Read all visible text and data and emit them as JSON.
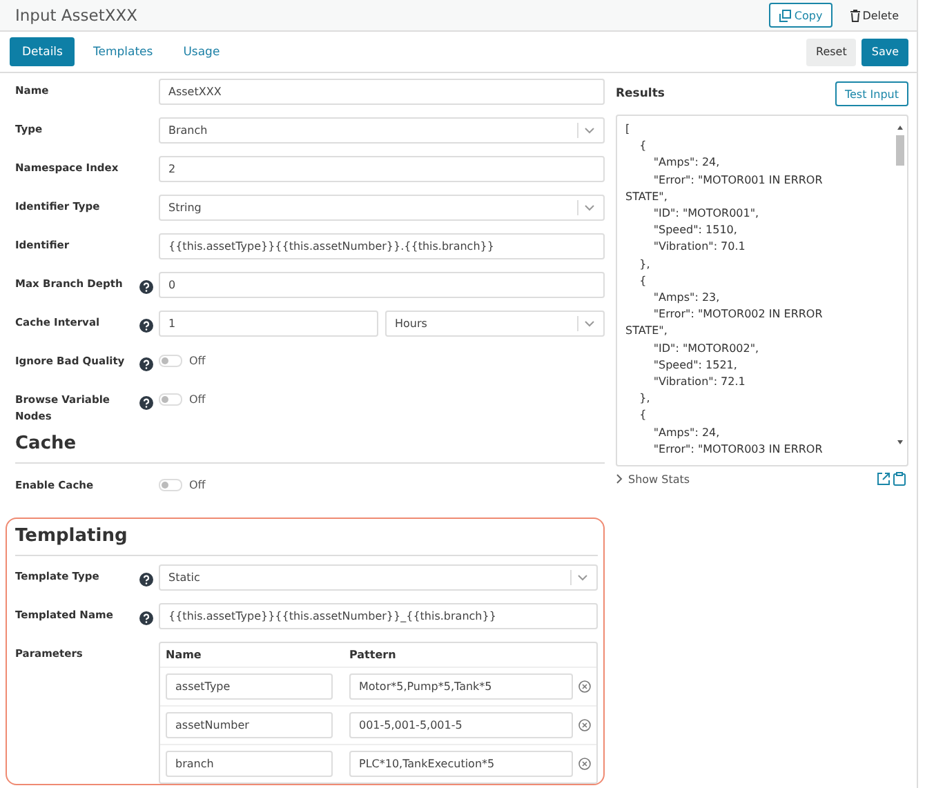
{
  "window": {
    "title": "Input AssetXXX"
  },
  "header_actions": [
    {
      "kind": "copy",
      "label": "Copy"
    },
    {
      "kind": "delete",
      "label": "Delete"
    }
  ],
  "tabs": [
    {
      "label": "Details",
      "selected": true
    },
    {
      "label": "Templates",
      "selected": false
    },
    {
      "label": "Usage",
      "selected": false
    }
  ],
  "form_actions": [
    {
      "kind": "reset",
      "label": "Reset"
    },
    {
      "kind": "save",
      "label": "Save"
    }
  ],
  "fields": [
    {
      "label": "Name",
      "kind": "text",
      "help": false,
      "value": "AssetXXX"
    },
    {
      "label": "Type",
      "kind": "select",
      "help": false,
      "value": "Branch"
    },
    {
      "label": "Namespace Index",
      "kind": "text",
      "help": false,
      "value": "2"
    },
    {
      "label": "Identifier Type",
      "kind": "select",
      "help": false,
      "value": "String"
    },
    {
      "label": "Identifier",
      "kind": "text",
      "help": false,
      "value": "{{this.assetType}}{{this.assetNumber}}.{{this.branch}}"
    },
    {
      "label": "Max Branch Depth",
      "kind": "text",
      "help": true,
      "value": "0"
    },
    {
      "label": "Cache Interval",
      "kind": "interval",
      "help": true,
      "value": "1",
      "unit": "Hours"
    },
    {
      "label": "Ignore Bad Quality",
      "kind": "toggle",
      "help": true,
      "on": false,
      "value": "Off"
    },
    {
      "label": "Browse Variable Nodes",
      "kind": "toggle",
      "help": true,
      "on": false,
      "value": "Off"
    }
  ],
  "cache": {
    "title": "Cache",
    "fields": [
      {
        "label": "Enable Cache",
        "kind": "toggle",
        "help": false,
        "on": false,
        "value": "Off"
      }
    ]
  },
  "templating": {
    "title": "Templating",
    "fields": [
      {
        "label": "Template Type",
        "kind": "select",
        "help": true,
        "value": "Static"
      },
      {
        "label": "Templated Name",
        "kind": "text",
        "help": true,
        "value": "{{this.assetType}}{{this.assetNumber}}_{{this.branch}}"
      }
    ],
    "parameters": {
      "label": "Parameters",
      "columns": [
        "Name",
        "Pattern"
      ],
      "rows": [
        {
          "name": "assetType",
          "pattern": "Motor*5,Pump*5,Tank*5"
        },
        {
          "name": "assetNumber",
          "pattern": "001-5,001-5,001-5"
        },
        {
          "name": "branch",
          "pattern": "PLC*10,TankExecution*5"
        }
      ]
    }
  },
  "results": {
    "title": "Results",
    "button": "Test Input",
    "text": "[\n\t{\n\t\t\"Amps\": 24,\n\t\t\"Error\": \"MOTOR001 IN ERROR\nSTATE\",\n\t\t\"ID\": \"MOTOR001\",\n\t\t\"Speed\": 1510,\n\t\t\"Vibration\": 70.1\n\t},\n\t{\n\t\t\"Amps\": 23,\n\t\t\"Error\": \"MOTOR002 IN ERROR\nSTATE\",\n\t\t\"ID\": \"MOTOR002\",\n\t\t\"Speed\": 1521,\n\t\t\"Vibration\": 72.1\n\t},\n\t{\n\t\t\"Amps\": 24,\n\t\t\"Error\": \"MOTOR003 IN ERROR",
    "stats": "Show Stats"
  }
}
